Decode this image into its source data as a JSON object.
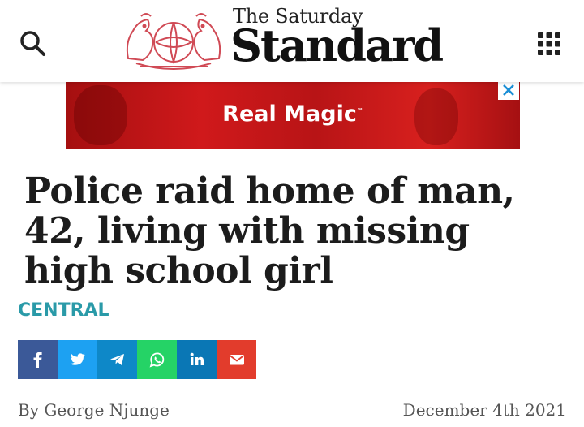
{
  "header": {
    "masthead_small": "The Saturday",
    "masthead_big": "Standard",
    "search_icon": "search-icon",
    "menu_icon": "grid-menu-icon",
    "logo_icon": "lion-crest-seal"
  },
  "ad": {
    "text": "Real Magic",
    "trademark": "™",
    "close_icon": "close-icon",
    "background_color": "#c8161a"
  },
  "article": {
    "headline": "Police raid home of man, 42, living with missing high school girl",
    "category": "CENTRAL",
    "category_color": "#2a9aa8",
    "author": "By George Njunge",
    "date": "December 4th 2021"
  },
  "share": [
    {
      "network": "facebook",
      "label": "f",
      "color": "#3b5998"
    },
    {
      "network": "twitter",
      "label": "",
      "color": "#1da1f2"
    },
    {
      "network": "telegram",
      "label": "",
      "color": "#0e88c8"
    },
    {
      "network": "whatsapp",
      "label": "",
      "color": "#25d366"
    },
    {
      "network": "linkedin",
      "label": "in",
      "color": "#0a77b5"
    },
    {
      "network": "email",
      "label": "",
      "color": "#e23c2c"
    }
  ]
}
